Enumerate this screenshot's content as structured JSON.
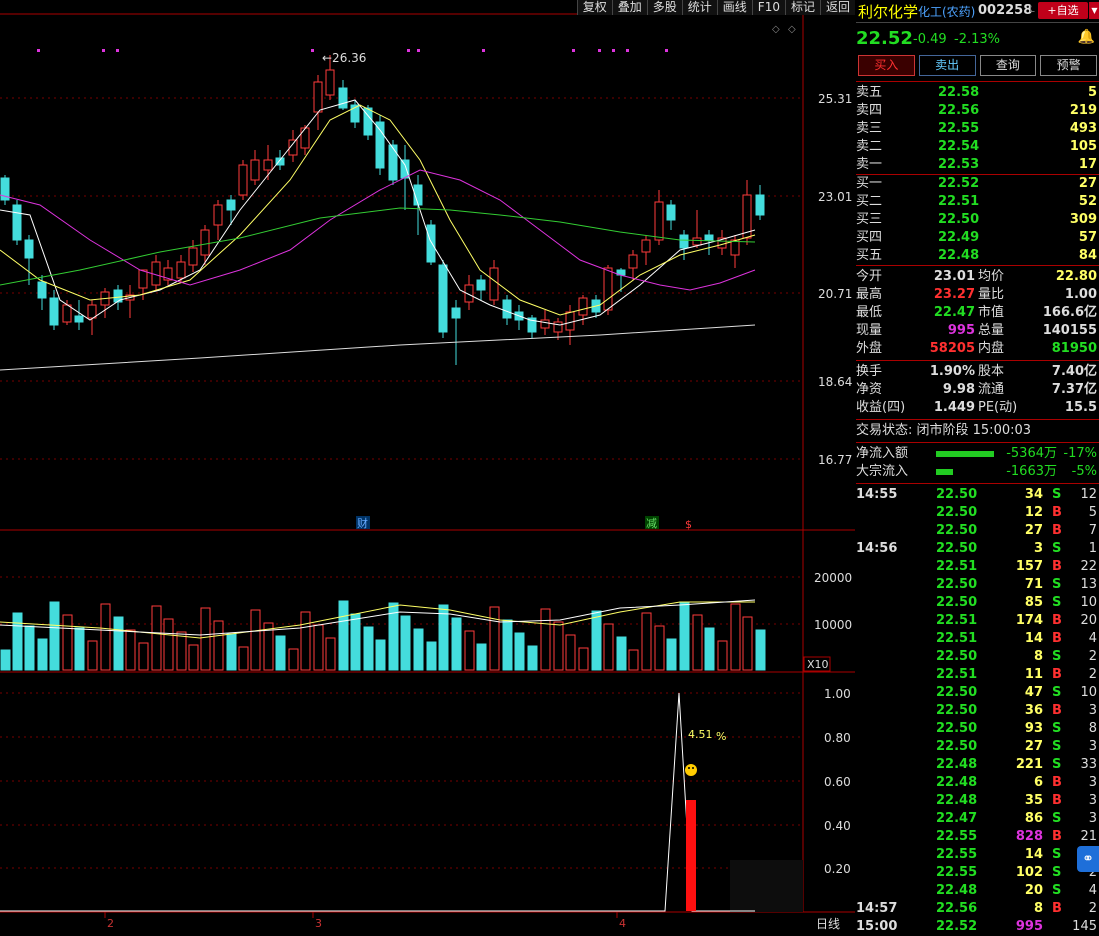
{
  "toolbar": [
    "复权",
    "叠加",
    "多股",
    "统计",
    "画线",
    "F10",
    "标记",
    "返回"
  ],
  "chart": {
    "peak_label": "26.36",
    "y_labels": [
      "25.31",
      "23.01",
      "20.71",
      "18.64",
      "16.77"
    ],
    "vol_labels": [
      "20000",
      "10000"
    ],
    "vol_unit": "X10",
    "ind_labels": [
      "1.00",
      "0.80",
      "0.60",
      "0.40",
      "0.20"
    ],
    "ind_value": "4.51",
    "ind_unit": "%",
    "x_labels": [
      "2",
      "3",
      "4"
    ],
    "period": "日线",
    "markers": [
      "财",
      "减",
      "$"
    ]
  },
  "stock": {
    "name": "利尔化学",
    "tag": "化工(农药)",
    "code": "002258",
    "level": "L",
    "add_btn": "+自选",
    "price": "22.52",
    "change": "-0.49",
    "pct": "-2.13%"
  },
  "buttons": [
    "买入",
    "卖出",
    "查询",
    "预警"
  ],
  "asks": [
    {
      "label": "卖五",
      "price": "22.58",
      "vol": "5"
    },
    {
      "label": "卖四",
      "price": "22.56",
      "vol": "219"
    },
    {
      "label": "卖三",
      "price": "22.55",
      "vol": "493"
    },
    {
      "label": "卖二",
      "price": "22.54",
      "vol": "105"
    },
    {
      "label": "卖一",
      "price": "22.53",
      "vol": "17"
    }
  ],
  "bids": [
    {
      "label": "买一",
      "price": "22.52",
      "vol": "27"
    },
    {
      "label": "买二",
      "price": "22.51",
      "vol": "52"
    },
    {
      "label": "买三",
      "price": "22.50",
      "vol": "309"
    },
    {
      "label": "买四",
      "price": "22.49",
      "vol": "57"
    },
    {
      "label": "买五",
      "price": "22.48",
      "vol": "84"
    }
  ],
  "stats1": [
    {
      "l1": "今开",
      "v1": "23.01",
      "l2": "均价",
      "v2": "22.80"
    },
    {
      "l1": "最高",
      "v1": "23.27",
      "l2": "量比",
      "v2": "1.00"
    },
    {
      "l1": "最低",
      "v1": "22.47",
      "l2": "市值",
      "v2": "166.6亿"
    },
    {
      "l1": "现量",
      "v1": "995",
      "l2": "总量",
      "v2": "140155"
    },
    {
      "l1": "外盘",
      "v1": "58205",
      "l2": "内盘",
      "v2": "81950"
    }
  ],
  "stats2": [
    {
      "l1": "换手",
      "v1": "1.90%",
      "l2": "股本",
      "v2": "7.40亿"
    },
    {
      "l1": "净资",
      "v1": "9.98",
      "l2": "流通",
      "v2": "7.37亿"
    },
    {
      "l1": "收益(四)",
      "v1": "1.449",
      "l2": "PE(动)",
      "v2": "15.5"
    }
  ],
  "trade_status": "交易状态: 闭市阶段 15:00:03",
  "flows": [
    {
      "label": "净流入额",
      "value": "-5364万",
      "pct": "-17%",
      "bar": 0.17
    },
    {
      "label": "大宗流入",
      "value": "-1663万",
      "pct": "-5%",
      "bar": 0.05
    }
  ],
  "ticks": [
    {
      "t": "14:55",
      "p": "22.50",
      "v": "34",
      "s": "S",
      "n": "12"
    },
    {
      "t": "",
      "p": "22.50",
      "v": "12",
      "s": "B",
      "n": "5"
    },
    {
      "t": "",
      "p": "22.50",
      "v": "27",
      "s": "B",
      "n": "7"
    },
    {
      "t": "14:56",
      "p": "22.50",
      "v": "3",
      "s": "S",
      "n": "1"
    },
    {
      "t": "",
      "p": "22.51",
      "v": "157",
      "s": "B",
      "n": "22"
    },
    {
      "t": "",
      "p": "22.50",
      "v": "71",
      "s": "S",
      "n": "13"
    },
    {
      "t": "",
      "p": "22.50",
      "v": "85",
      "s": "S",
      "n": "10"
    },
    {
      "t": "",
      "p": "22.51",
      "v": "174",
      "s": "B",
      "n": "20"
    },
    {
      "t": "",
      "p": "22.51",
      "v": "14",
      "s": "B",
      "n": "4"
    },
    {
      "t": "",
      "p": "22.50",
      "v": "8",
      "s": "S",
      "n": "2"
    },
    {
      "t": "",
      "p": "22.51",
      "v": "11",
      "s": "B",
      "n": "2"
    },
    {
      "t": "",
      "p": "22.50",
      "v": "47",
      "s": "S",
      "n": "10"
    },
    {
      "t": "",
      "p": "22.50",
      "v": "36",
      "s": "B",
      "n": "3"
    },
    {
      "t": "",
      "p": "22.50",
      "v": "93",
      "s": "S",
      "n": "8"
    },
    {
      "t": "",
      "p": "22.50",
      "v": "27",
      "s": "S",
      "n": "3"
    },
    {
      "t": "",
      "p": "22.48",
      "v": "221",
      "s": "S",
      "n": "33"
    },
    {
      "t": "",
      "p": "22.48",
      "v": "6",
      "s": "B",
      "n": "3"
    },
    {
      "t": "",
      "p": "22.48",
      "v": "35",
      "s": "B",
      "n": "3"
    },
    {
      "t": "",
      "p": "22.47",
      "v": "86",
      "s": "S",
      "n": "3"
    },
    {
      "t": "",
      "p": "22.55",
      "v": "828",
      "s": "B",
      "n": "21"
    },
    {
      "t": "",
      "p": "22.55",
      "v": "14",
      "s": "S",
      "n": "2"
    },
    {
      "t": "",
      "p": "22.55",
      "v": "102",
      "s": "S",
      "n": "2"
    },
    {
      "t": "",
      "p": "22.48",
      "v": "20",
      "s": "S",
      "n": "4"
    },
    {
      "t": "14:57",
      "p": "22.56",
      "v": "8",
      "s": "B",
      "n": "2"
    },
    {
      "t": "15:00",
      "p": "22.52",
      "v": "995",
      "s": "",
      "n": "145"
    }
  ]
}
